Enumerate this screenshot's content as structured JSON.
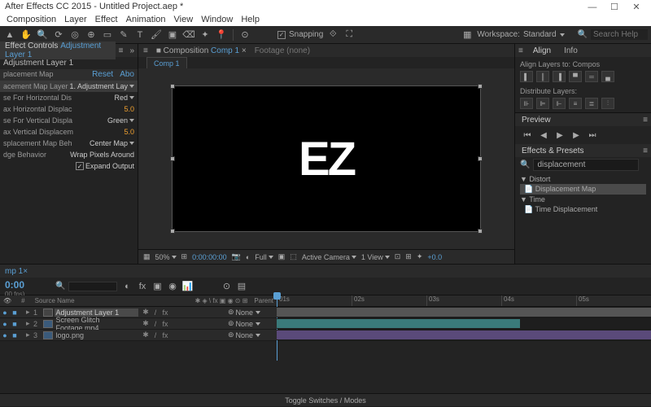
{
  "title": "After Effects CC 2015 - Untitled Project.aep *",
  "menu": [
    "Composition",
    "Layer",
    "Effect",
    "Animation",
    "View",
    "Window",
    "Help"
  ],
  "toolbar": {
    "snapping_label": "Snapping",
    "workspace_label": "Workspace:",
    "workspace_value": "Standard",
    "search_placeholder": "Search Help"
  },
  "effect_controls": {
    "tab": "Effect Controls",
    "layer_name": "Adjustment Layer 1",
    "header": "Adjustment Layer 1",
    "effect_name": "placement Map",
    "reset": "Reset",
    "about": "Abo",
    "props": [
      {
        "label": "acement Map Layer",
        "value": "1. Adjustment Lay",
        "type": "drop"
      },
      {
        "label": "se For Horizontal Dis",
        "value": "Red",
        "type": "drop"
      },
      {
        "label": "ax Horizontal Displac",
        "value": "5.0",
        "type": "num"
      },
      {
        "label": "se For Vertical Displa",
        "value": "Green",
        "type": "drop"
      },
      {
        "label": "ax Vertical Displacem",
        "value": "5.0",
        "type": "num"
      },
      {
        "label": "splacement Map Beh",
        "value": "Center Map",
        "type": "drop"
      },
      {
        "label": "dge Behavior",
        "value": "Wrap Pixels Around",
        "type": "text"
      },
      {
        "label": "",
        "value": "Expand Output",
        "type": "check"
      }
    ]
  },
  "composition": {
    "tab_prefix": "Composition",
    "name": "Comp 1",
    "footage": "Footage (none)",
    "canvas_text": "EZ",
    "controls": {
      "zoom": "50%",
      "timecode": "0:00:00:00",
      "res": "Full",
      "camera": "Active Camera",
      "view": "1 View",
      "exposure": "+0.0"
    }
  },
  "align_panel": {
    "tabs": [
      "Align",
      "Info"
    ],
    "align_to_label": "Align Layers to:",
    "align_to_value": "Compos",
    "distribute_label": "Distribute Layers:"
  },
  "preview_panel": {
    "title": "Preview"
  },
  "effects_presets": {
    "title": "Effects & Presets",
    "search_value": "displacement",
    "tree": [
      {
        "label": "Distort",
        "type": "folder"
      },
      {
        "label": "Displacement Map",
        "type": "preset",
        "selected": true
      },
      {
        "label": "Time",
        "type": "folder"
      },
      {
        "label": "Time Displacement",
        "type": "preset"
      }
    ]
  },
  "timeline": {
    "tab": "mp 1",
    "timecode": "0:00",
    "fps": "00 fps)",
    "col_source": "Source Name",
    "col_parent": "Parent",
    "ticks": [
      "01s",
      "02s",
      "03s",
      "04s",
      "05s"
    ],
    "layers": [
      {
        "idx": "1",
        "name": "Adjustment Layer 1",
        "parent": "None",
        "bar": "grey",
        "hl": true
      },
      {
        "idx": "2",
        "name": "Screen Glitch Footage.mp4",
        "parent": "None",
        "bar": "teal",
        "icon": "blue"
      },
      {
        "idx": "3",
        "name": "logo.png",
        "parent": "None",
        "bar": "purple",
        "icon": "blue"
      }
    ],
    "footer": "Toggle Switches / Modes"
  }
}
